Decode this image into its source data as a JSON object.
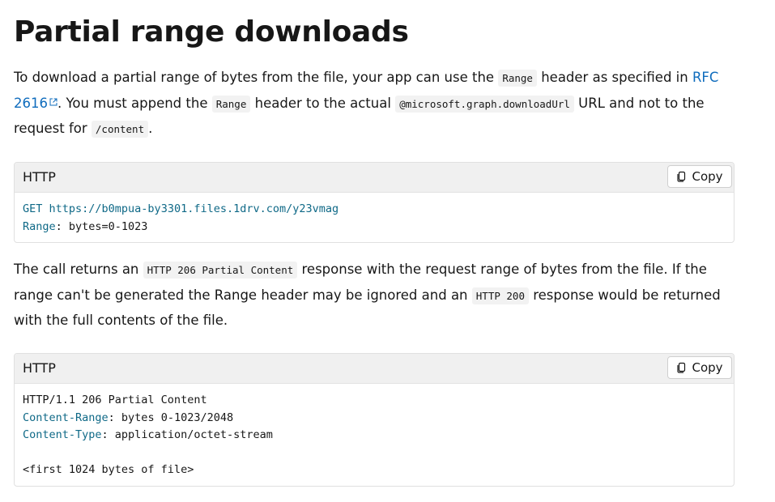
{
  "heading": "Partial range downloads",
  "intro": {
    "t1": "To download a partial range of bytes from the file, your app can use the ",
    "code1": "Range",
    "t2": " header as specified in ",
    "link_text": "RFC 2616",
    "t3": ". You must append the ",
    "code2": "Range",
    "t4": " header to the actual ",
    "code3": "@microsoft.graph.downloadUrl",
    "t5": " URL and not to the request for ",
    "code4": "/content",
    "t6": "."
  },
  "code_block_1": {
    "language": "HTTP",
    "copy_label": "Copy",
    "line1_method": "GET",
    "line1_url": " https://b0mpua-by3301.files.1drv.com/y23vmag",
    "line2_key": "Range",
    "line2_value": ": bytes=0-1023"
  },
  "response_text": {
    "t1": "The call returns an ",
    "code1": "HTTP 206 Partial Content",
    "t2": " response with the request range of bytes from the file. If the range can't be generated the Range header may be ignored and an ",
    "code2": "HTTP 200",
    "t3": " response would be returned with the full contents of the file."
  },
  "code_block_2": {
    "language": "HTTP",
    "copy_label": "Copy",
    "line1": "HTTP/1.1 206 Partial Content",
    "line2_key": "Content-Range",
    "line2_value": ": bytes 0-1023/2048",
    "line3_key": "Content-Type",
    "line3_value": ": application/octet-stream",
    "line5": "<first 1024 bytes of file>"
  },
  "colors": {
    "link": "#0f6cbd",
    "code_keyword": "#0f6987",
    "code_inline_bg": "#f2f2f2",
    "code_header_bg": "#f0f0f0"
  }
}
